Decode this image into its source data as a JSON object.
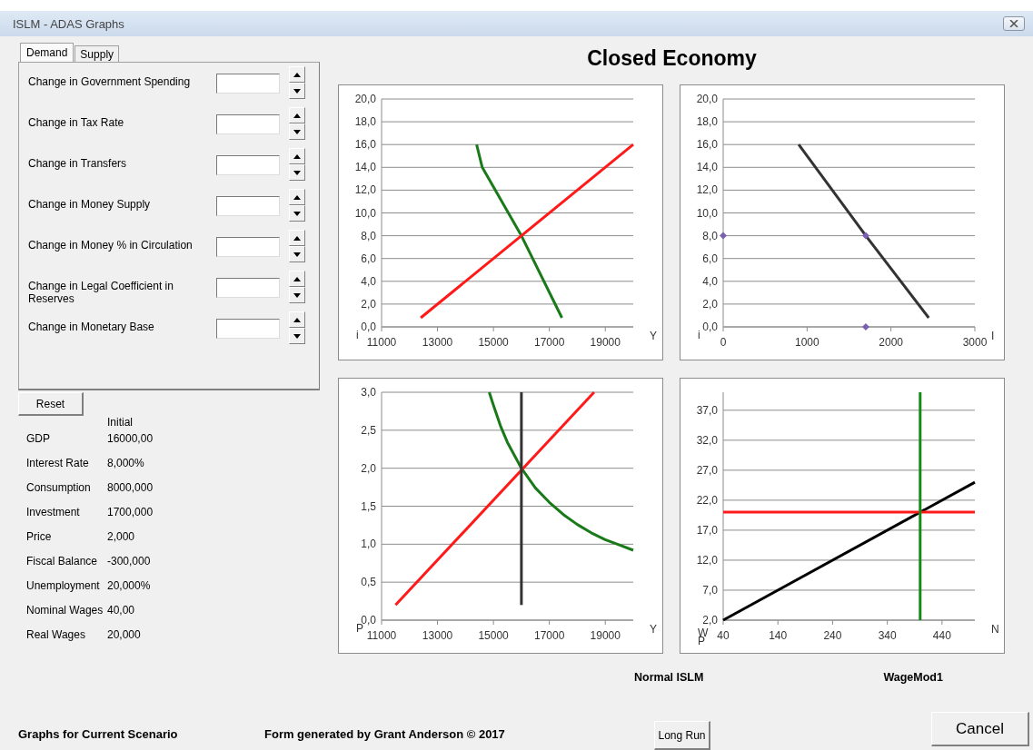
{
  "window": {
    "title": "ISLM - ADAS Graphs"
  },
  "tabs": [
    {
      "label": "Demand",
      "selected": true
    },
    {
      "label": "Supply",
      "selected": false
    }
  ],
  "inputs": [
    {
      "label": "Change in Government Spending"
    },
    {
      "label": "Change in Tax Rate"
    },
    {
      "label": "Change in Transfers"
    },
    {
      "label": "Change in Money Supply"
    },
    {
      "label": "Change in Money % in Circulation"
    },
    {
      "label": "Change in Legal Coefficient in Reserves"
    },
    {
      "label": "Change in Monetary Base"
    }
  ],
  "reset_button": "Reset",
  "results": {
    "header": "Initial",
    "rows": [
      {
        "label": "GDP",
        "value": "16000,00"
      },
      {
        "label": "Interest Rate",
        "value": "8,000%"
      },
      {
        "label": "Consumption",
        "value": "8000,000"
      },
      {
        "label": "Investment",
        "value": "1700,000"
      },
      {
        "label": "Price",
        "value": "2,000"
      },
      {
        "label": "Fiscal Balance",
        "value": "-300,000"
      },
      {
        "label": "Unemployment",
        "value": "20,000%"
      },
      {
        "label": "Nominal Wages",
        "value": "40,00"
      },
      {
        "label": "Real Wages",
        "value": "20,000"
      }
    ]
  },
  "heading": "Closed Economy",
  "charts": [
    {
      "chart_data": {
        "type": "line",
        "grid": true,
        "xlabel": "Y",
        "ylabel": "i",
        "xlim": [
          11000,
          20000
        ],
        "ylim": [
          0,
          20
        ],
        "xticks": [
          11000,
          13000,
          15000,
          17000,
          19000
        ],
        "yticks": [
          {
            "value": 0,
            "label": "0,0"
          },
          {
            "value": 2,
            "label": "2,0"
          },
          {
            "value": 4,
            "label": "4,0"
          },
          {
            "value": 6,
            "label": "6,0"
          },
          {
            "value": 8,
            "label": "8,0"
          },
          {
            "value": 10,
            "label": "10,0"
          },
          {
            "value": 12,
            "label": "12,0"
          },
          {
            "value": 14,
            "label": "14,0"
          },
          {
            "value": 16,
            "label": "16,0"
          },
          {
            "value": 18,
            "label": "18,0"
          },
          {
            "value": 20,
            "label": "20,0"
          }
        ],
        "series": [
          {
            "color": "#1a7a1a",
            "x": [
              14400,
              14600,
              16000,
              17450
            ],
            "values": [
              16,
              14,
              8,
              0.8
            ]
          },
          {
            "color": "#ff1a1a",
            "x": [
              12400,
              16000,
              20000
            ],
            "values": [
              0.8,
              8,
              16
            ]
          }
        ]
      }
    },
    {
      "chart_data": {
        "type": "line",
        "grid": true,
        "xlabel": "I",
        "ylabel": "i",
        "xlim": [
          0,
          3000
        ],
        "ylim": [
          0,
          20
        ],
        "xticks": [
          0,
          1000,
          2000,
          3000
        ],
        "yticks": [
          {
            "value": 0,
            "label": "0,0"
          },
          {
            "value": 2,
            "label": "2,0"
          },
          {
            "value": 4,
            "label": "4,0"
          },
          {
            "value": 6,
            "label": "6,0"
          },
          {
            "value": 8,
            "label": "8,0"
          },
          {
            "value": 10,
            "label": "10,0"
          },
          {
            "value": 12,
            "label": "12,0"
          },
          {
            "value": 14,
            "label": "14,0"
          },
          {
            "value": 16,
            "label": "16,0"
          },
          {
            "value": 18,
            "label": "18,0"
          },
          {
            "value": 20,
            "label": "20,0"
          }
        ],
        "series": [
          {
            "color": "#333333",
            "x": [
              900,
              1700,
              2450
            ],
            "values": [
              16,
              8,
              0.8
            ]
          },
          {
            "type": "scatter",
            "color": "#7b5fb0",
            "x": [
              0,
              1700,
              1700
            ],
            "values": [
              8,
              8,
              0
            ]
          }
        ]
      }
    },
    {
      "chart_data": {
        "type": "line",
        "grid": true,
        "xlabel": "Y",
        "ylabel": "P",
        "xlim": [
          11000,
          20000
        ],
        "ylim": [
          0,
          3
        ],
        "xticks": [
          11000,
          13000,
          15000,
          17000,
          19000
        ],
        "yticks": [
          {
            "value": 0,
            "label": "0,0"
          },
          {
            "value": 0.5,
            "label": "0,5"
          },
          {
            "value": 1,
            "label": "1,0"
          },
          {
            "value": 1.5,
            "label": "1,5"
          },
          {
            "value": 2,
            "label": "2,0"
          },
          {
            "value": 2.5,
            "label": "2,5"
          },
          {
            "value": 3,
            "label": "3,0"
          }
        ],
        "series": [
          {
            "color": "#1a7a1a",
            "x": [
              14850,
              15000,
              15250,
              15500,
              16000,
              16500,
              17000,
              17500,
              18000,
              18500,
              19000,
              19500,
              20000
            ],
            "values": [
              3.0,
              2.83,
              2.56,
              2.34,
              2.0,
              1.74,
              1.55,
              1.39,
              1.26,
              1.15,
              1.06,
              0.99,
              0.92
            ]
          },
          {
            "color": "#ff1a1a",
            "x": [
              11500,
              18600
            ],
            "values": [
              0.2,
              3.0
            ]
          },
          {
            "color": "#333333",
            "x": [
              16000,
              16000
            ],
            "values": [
              0.2,
              3.0
            ]
          }
        ]
      }
    },
    {
      "chart_data": {
        "type": "line",
        "grid": true,
        "xlabel": "N",
        "ylabel": "W P",
        "xlim": [
          40,
          500
        ],
        "ylim": [
          2,
          40
        ],
        "xticks": [
          40,
          140,
          240,
          340,
          440
        ],
        "yticks": [
          {
            "value": 2,
            "label": "2,0"
          },
          {
            "value": 7,
            "label": "7,0"
          },
          {
            "value": 12,
            "label": "12,0"
          },
          {
            "value": 17,
            "label": "17,0"
          },
          {
            "value": 22,
            "label": "22,0"
          },
          {
            "value": 27,
            "label": "27,0"
          },
          {
            "value": 32,
            "label": "32,0"
          },
          {
            "value": 37,
            "label": "37,0"
          }
        ],
        "series": [
          {
            "color": "#000000",
            "x": [
              40,
              500
            ],
            "values": [
              2,
              25
            ]
          },
          {
            "color": "#ff1a1a",
            "x": [
              40,
              500
            ],
            "values": [
              20,
              20
            ]
          },
          {
            "color": "#158a15",
            "x": [
              400,
              400
            ],
            "values": [
              2,
              40
            ]
          }
        ]
      }
    }
  ],
  "captions": [
    "Normal ISLM",
    "WageMod1"
  ],
  "footer": {
    "scenario": "Graphs for Current Scenario",
    "credit": "Form generated by Grant Anderson © 2017"
  },
  "buttons": [
    {
      "label": "Long Run"
    },
    {
      "label": "Cancel"
    }
  ]
}
